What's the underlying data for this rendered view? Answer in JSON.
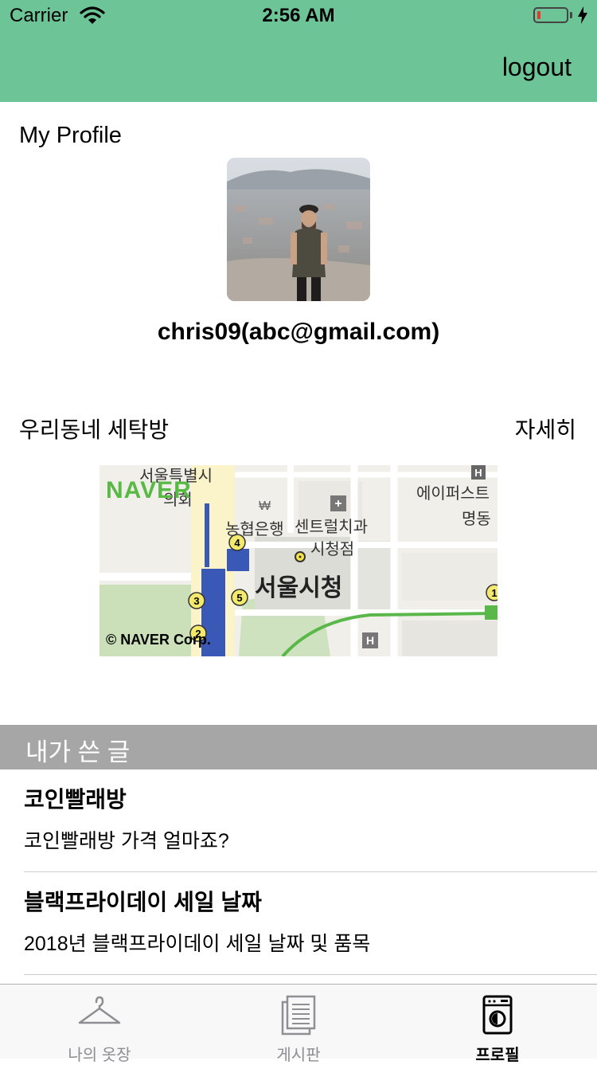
{
  "status_bar": {
    "carrier": "Carrier",
    "time": "2:56 AM",
    "battery_level": 0.1
  },
  "header": {
    "logout_label": "logout",
    "background_color": "#6dc597"
  },
  "profile": {
    "section_title": "My Profile",
    "user_line": "chris09(abc@gmail.com)"
  },
  "laundry": {
    "title": "우리동네 세탁방",
    "details_label": "자세히",
    "map": {
      "provider_logo": "NAVER",
      "copyright": "© NAVER Corp.",
      "labels": [
        "서울특별시",
        "의회",
        "농협은행",
        "센트럴치과",
        "시청점",
        "서울시청",
        "에이퍼스트",
        "명동"
      ],
      "station_badges": [
        "4",
        "3",
        "5",
        "2",
        "1"
      ]
    }
  },
  "posts": {
    "section_title": "내가 쓴 글",
    "items": [
      {
        "title": "코인빨래방",
        "body": "코인빨래방 가격 얼마죠?"
      },
      {
        "title": "블랙프라이데이 세일 날짜",
        "body": "2018년 블랙프라이데이 세일 날짜 및 품목"
      }
    ]
  },
  "tabbar": {
    "tabs": [
      {
        "label": "나의 옷장",
        "icon": "hanger-icon",
        "active": false
      },
      {
        "label": "게시판",
        "icon": "document-icon",
        "active": false
      },
      {
        "label": "프로필",
        "icon": "washing-machine-icon",
        "active": true
      }
    ]
  }
}
